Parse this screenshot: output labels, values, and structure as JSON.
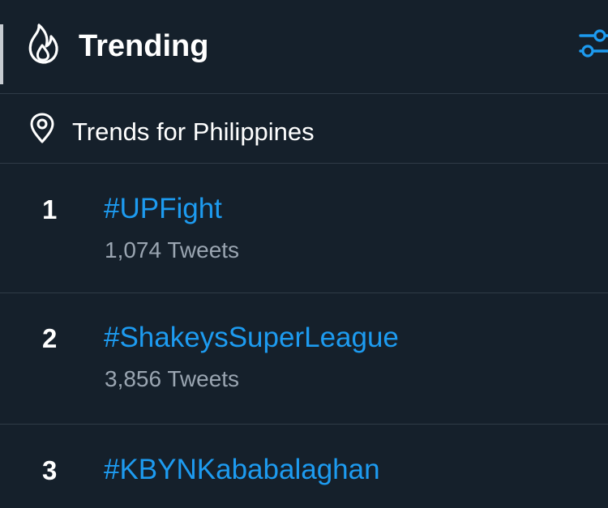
{
  "header": {
    "title": "Trending",
    "icon": "flame-icon",
    "settings_icon": "settings-sliders-icon"
  },
  "location": {
    "icon": "location-pin-icon",
    "label": "Trends for Philippines"
  },
  "trends": [
    {
      "rank": "1",
      "tag": "#UPFight",
      "count": "1,074 Tweets"
    },
    {
      "rank": "2",
      "tag": "#ShakeysSuperLeague",
      "count": "3,856 Tweets"
    },
    {
      "rank": "3",
      "tag": "#KBYNKababalaghan"
    }
  ],
  "colors": {
    "background": "#15202b",
    "accent": "#1d9bf0",
    "text": "#ffffff",
    "secondary_text": "#9aa5b1",
    "divider": "#2f3b47"
  }
}
